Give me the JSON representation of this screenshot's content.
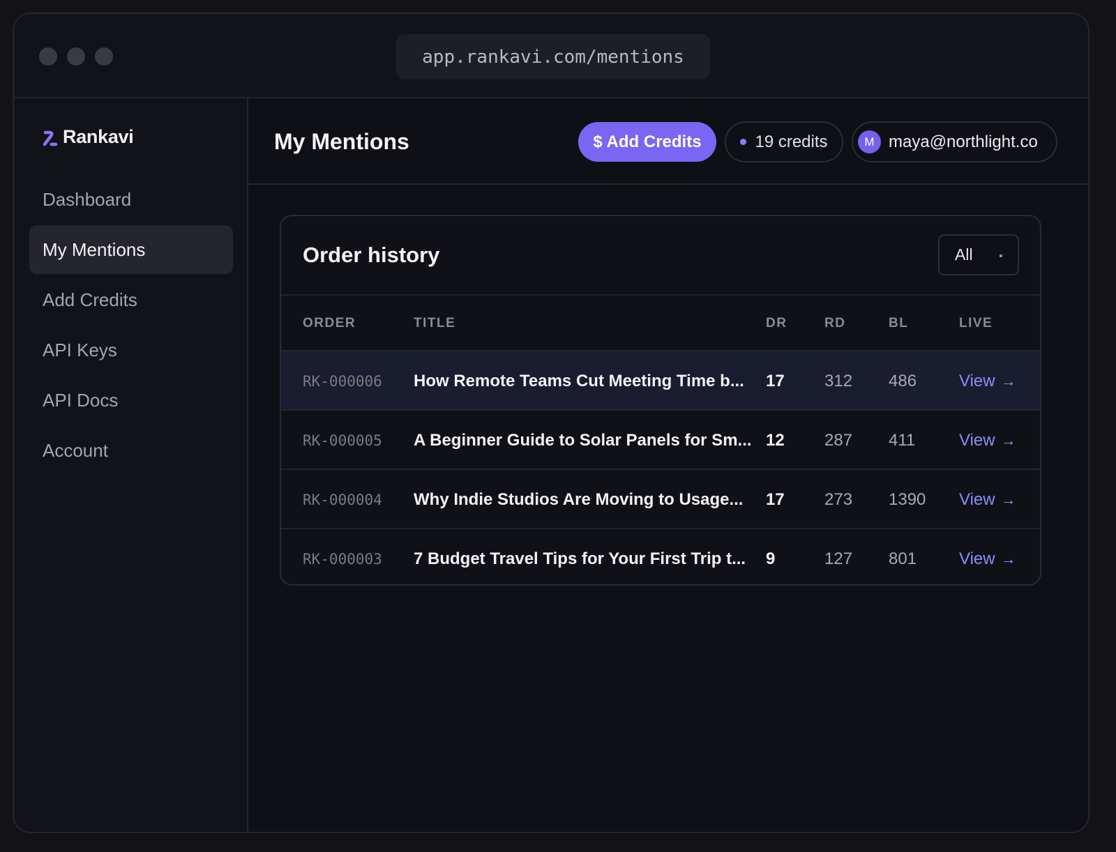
{
  "browser": {
    "url": "app.rankavi.com/mentions"
  },
  "sidebar": {
    "brand": "Rankavi",
    "items": [
      {
        "label": "Dashboard",
        "active": false
      },
      {
        "label": "My Mentions",
        "active": true
      },
      {
        "label": "Add Credits",
        "active": false
      },
      {
        "label": "API Keys",
        "active": false
      },
      {
        "label": "API Docs",
        "active": false
      },
      {
        "label": "Account",
        "active": false
      }
    ]
  },
  "header": {
    "title": "My Mentions",
    "add_credits_label": "$ Add Credits",
    "credits_label": "19 credits",
    "user_initial": "M",
    "user_email": "maya@northlight.co"
  },
  "order_history": {
    "title": "Order history",
    "filter_value": "All",
    "columns": [
      "ORDER",
      "TITLE",
      "DR",
      "RD",
      "BL",
      "LIVE"
    ],
    "rows": [
      {
        "order": "RK-000006",
        "title": "How Remote Teams Cut Meeting Time b...",
        "dr": "17",
        "rd": "312",
        "bl": "486",
        "live": "View",
        "highlighted": true
      },
      {
        "order": "RK-000005",
        "title": "A Beginner Guide to Solar Panels for Sm...",
        "dr": "12",
        "rd": "287",
        "bl": "411",
        "live": "View",
        "highlighted": false
      },
      {
        "order": "RK-000004",
        "title": "Why Indie Studios Are Moving to Usage...",
        "dr": "17",
        "rd": "273",
        "bl": "1390",
        "live": "View",
        "highlighted": false
      },
      {
        "order": "RK-000003",
        "title": "7 Budget Travel Tips for Your First Trip t...",
        "dr": "9",
        "rd": "127",
        "bl": "801",
        "live": "View",
        "highlighted": false
      }
    ]
  },
  "colors": {
    "accent": "#7a66f2",
    "link": "#8b8cff",
    "background": "#0f1016",
    "highlight_row": "#1a1c2f"
  }
}
